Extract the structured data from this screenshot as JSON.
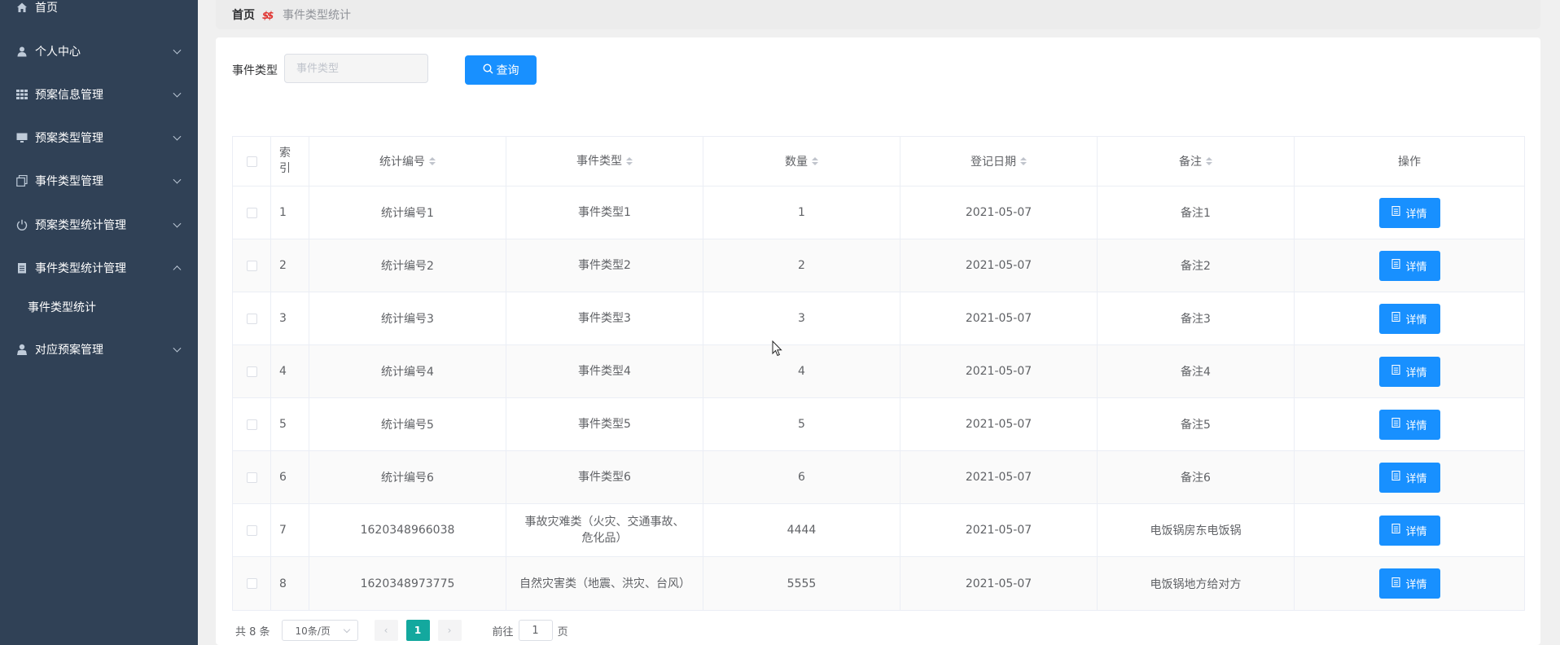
{
  "sidebar": {
    "items": [
      {
        "label": "首页",
        "icon": "home-icon"
      },
      {
        "label": "个人中心",
        "icon": "user-icon"
      },
      {
        "label": "预案信息管理",
        "icon": "grid-icon"
      },
      {
        "label": "预案类型管理",
        "icon": "monitor-icon"
      },
      {
        "label": "事件类型管理",
        "icon": "copy-icon"
      },
      {
        "label": "预案类型统计管理",
        "icon": "power-icon"
      },
      {
        "label": "事件类型统计管理",
        "icon": "document-icon",
        "expanded": true
      },
      {
        "label": "对应预案管理",
        "icon": "person-icon"
      }
    ],
    "submenu": {
      "label": "事件类型统计"
    }
  },
  "breadcrumb": {
    "home": "首页",
    "current": "事件类型统计"
  },
  "search": {
    "label": "事件类型",
    "placeholder": "事件类型",
    "button_label": "查询"
  },
  "table": {
    "headers": {
      "index": "索引",
      "code": "统计编号",
      "type": "事件类型",
      "qty": "数量",
      "date": "登记日期",
      "note": "备注",
      "ops": "操作"
    },
    "detail_label": "详情",
    "rows": [
      {
        "index": "1",
        "code": "统计编号1",
        "type": "事件类型1",
        "qty": "1",
        "date": "2021-05-07",
        "note": "备注1"
      },
      {
        "index": "2",
        "code": "统计编号2",
        "type": "事件类型2",
        "qty": "2",
        "date": "2021-05-07",
        "note": "备注2"
      },
      {
        "index": "3",
        "code": "统计编号3",
        "type": "事件类型3",
        "qty": "3",
        "date": "2021-05-07",
        "note": "备注3"
      },
      {
        "index": "4",
        "code": "统计编号4",
        "type": "事件类型4",
        "qty": "4",
        "date": "2021-05-07",
        "note": "备注4"
      },
      {
        "index": "5",
        "code": "统计编号5",
        "type": "事件类型5",
        "qty": "5",
        "date": "2021-05-07",
        "note": "备注5"
      },
      {
        "index": "6",
        "code": "统计编号6",
        "type": "事件类型6",
        "qty": "6",
        "date": "2021-05-07",
        "note": "备注6"
      },
      {
        "index": "7",
        "code": "1620348966038",
        "type": "事故灾难类（火灾、交通事故、危化品）",
        "qty": "4444",
        "date": "2021-05-07",
        "note": "电饭锅房东电饭锅"
      },
      {
        "index": "8",
        "code": "1620348973775",
        "type": "自然灾害类（地震、洪灾、台风）",
        "qty": "5555",
        "date": "2021-05-07",
        "note": "电饭锅地方给对方"
      }
    ]
  },
  "pagination": {
    "total": "共 8 条",
    "page_size": "10条/页",
    "current_page": "1",
    "goto_label": "前往",
    "goto_value": "1",
    "page_unit": "页"
  },
  "colors": {
    "sidebar_bg": "#304156",
    "primary": "#1890ff",
    "active_page": "#13a89e"
  }
}
